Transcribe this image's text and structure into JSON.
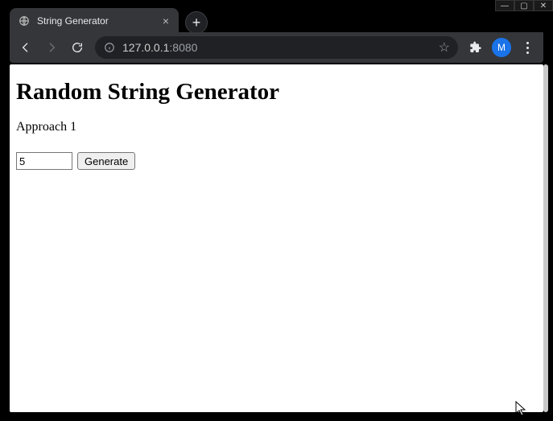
{
  "browser": {
    "tab_title": "String Generator",
    "url_host": "127.0.0.1",
    "url_port": ":8080",
    "avatar_letter": "M"
  },
  "page": {
    "heading": "Random String Generator",
    "subheading": "Approach 1",
    "input_value": "5",
    "button_label": "Generate"
  }
}
